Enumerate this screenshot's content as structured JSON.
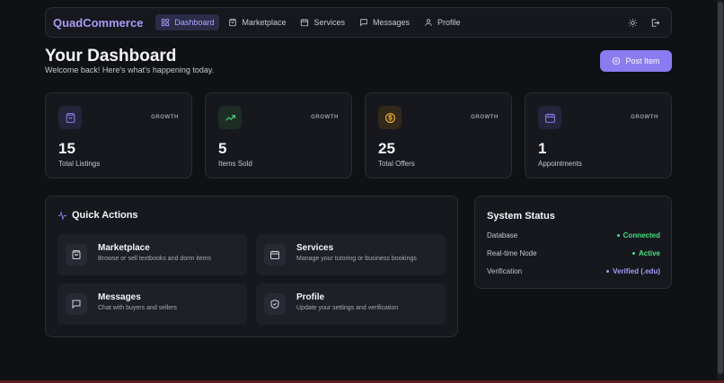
{
  "nav": {
    "brand": "QuadCommerce",
    "items": [
      {
        "label": "Dashboard",
        "icon": "dashboard-icon",
        "active": true
      },
      {
        "label": "Marketplace",
        "icon": "shopping-bag-icon",
        "active": false
      },
      {
        "label": "Services",
        "icon": "calendar-icon",
        "active": false
      },
      {
        "label": "Messages",
        "icon": "message-icon",
        "active": false
      },
      {
        "label": "Profile",
        "icon": "user-icon",
        "active": false
      }
    ],
    "right_icons": [
      "theme-toggle-icon",
      "logout-icon"
    ]
  },
  "header": {
    "title": "Your Dashboard",
    "subtitle": "Welcome back! Here's what's happening today.",
    "post_button": "Post Item"
  },
  "stats": [
    {
      "value": "15",
      "label": "Total Listings",
      "badge": "GROWTH",
      "icon": "shopping-bag-icon",
      "color": "#8b7bf0"
    },
    {
      "value": "5",
      "label": "Items Sold",
      "badge": "GROWTH",
      "icon": "trending-up-icon",
      "color": "#4ade80"
    },
    {
      "value": "25",
      "label": "Total Offers",
      "badge": "GROWTH",
      "icon": "dollar-icon",
      "color": "#f5b942"
    },
    {
      "value": "1",
      "label": "Appointments",
      "badge": "GROWTH",
      "icon": "calendar-icon",
      "color": "#8b7bf0"
    }
  ],
  "quick_actions": {
    "title": "Quick Actions",
    "items": [
      {
        "title": "Marketplace",
        "desc": "Browse or sell textbooks and dorm items",
        "icon": "shopping-bag-icon"
      },
      {
        "title": "Services",
        "desc": "Manage your tutoring or business bookings",
        "icon": "calendar-icon"
      },
      {
        "title": "Messages",
        "desc": "Chat with buyers and sellers",
        "icon": "message-icon"
      },
      {
        "title": "Profile",
        "desc": "Update your settings and verification",
        "icon": "shield-check-icon"
      }
    ]
  },
  "system_status": {
    "title": "System Status",
    "rows": [
      {
        "label": "Database",
        "value": "Connected",
        "color": "#4ade80"
      },
      {
        "label": "Real-time Node",
        "value": "Active",
        "color": "#4ade80"
      },
      {
        "label": "Verification",
        "value": "Verified (.edu)",
        "color": "#a99af5"
      }
    ]
  },
  "colors": {
    "accent": "#8b7bf0",
    "success": "#4ade80",
    "warning": "#f5b942",
    "background": "#0f1115",
    "card": "#16181e"
  }
}
